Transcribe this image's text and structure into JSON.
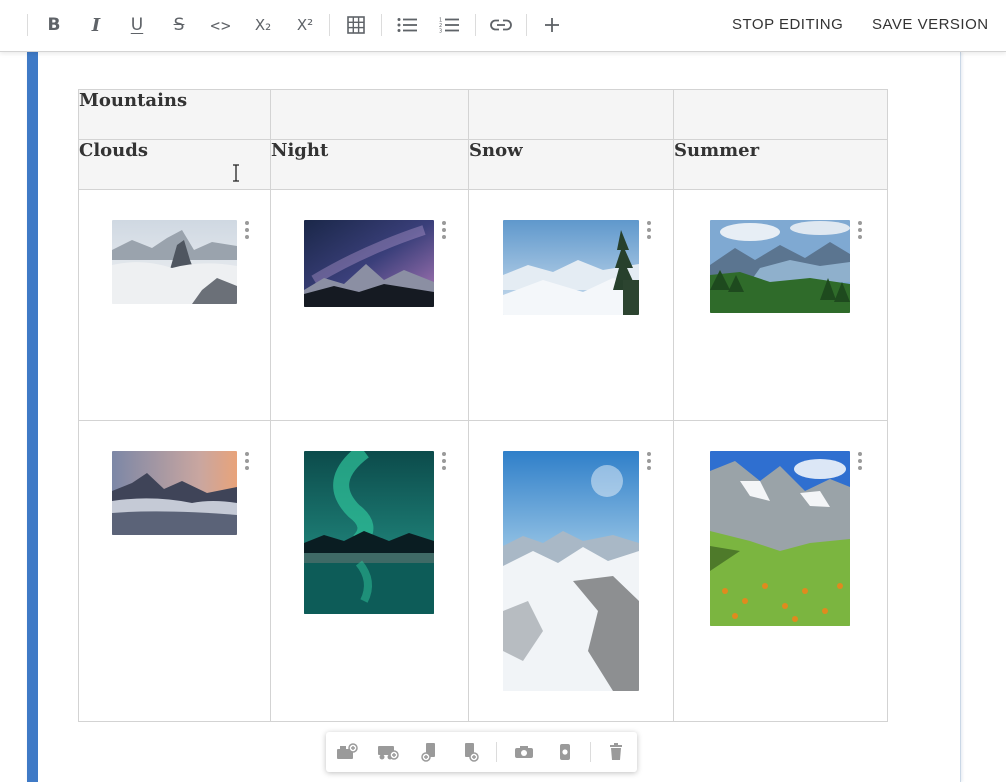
{
  "toolbar": {
    "buttons": [
      {
        "icon": "bold-icon",
        "glyph": "B"
      },
      {
        "icon": "italic-icon",
        "glyph": "I"
      },
      {
        "icon": "underline-icon",
        "glyph": "U"
      },
      {
        "icon": "strikethrough-icon",
        "glyph": "S"
      },
      {
        "icon": "code-icon",
        "glyph": "<>"
      },
      {
        "icon": "subscript-icon",
        "glyph": "X₂"
      },
      {
        "icon": "superscript-icon",
        "glyph": "X²"
      },
      {
        "icon": "table-icon"
      },
      {
        "icon": "bulleted-list-icon"
      },
      {
        "icon": "numbered-list-icon"
      },
      {
        "icon": "link-icon"
      },
      {
        "icon": "plus-icon"
      }
    ],
    "stop_editing_label": "STOP EDITING",
    "save_version_label": "SAVE VERSION"
  },
  "table": {
    "title_row": [
      "Mountains",
      "",
      "",
      ""
    ],
    "header_row": [
      "Clouds",
      "Night",
      "Snow",
      "Summer"
    ],
    "image_rows": [
      [
        {
          "alt": "Mountain peaks above clouds",
          "palette": [
            "#cfd8e2",
            "#5c6470",
            "#f2f3f4"
          ]
        },
        {
          "alt": "Mountains under the milky way at night",
          "palette": [
            "#1a2748",
            "#b07ab8",
            "#151a22"
          ]
        },
        {
          "alt": "Snowy mountain ridge with fir trees",
          "palette": [
            "#6fa3d2",
            "#dfe8f1",
            "#27402c"
          ]
        },
        {
          "alt": "Summer valley with green forest",
          "palette": [
            "#6f9fcc",
            "#44627b",
            "#2f6b2a"
          ]
        }
      ],
      [
        {
          "alt": "Mountains at sunset above sea of clouds",
          "palette": [
            "#7c87a6",
            "#e8a37a",
            "#3f4458"
          ]
        },
        {
          "alt": "Aurora over mountains and lake",
          "palette": [
            "#0c4b4b",
            "#2fc39a",
            "#0a1d22"
          ]
        },
        {
          "alt": "Snow covered mountains under blue sky",
          "palette": [
            "#2f7fc9",
            "#e9eef3",
            "#8d8f91"
          ]
        },
        {
          "alt": "Alpine meadow with flowers",
          "palette": [
            "#2f6fd0",
            "#9aa3a8",
            "#7bb540"
          ]
        }
      ]
    ]
  },
  "image_toolbar": {
    "buttons": [
      {
        "icon": "insert-row-above-icon"
      },
      {
        "icon": "insert-row-below-icon"
      },
      {
        "icon": "insert-column-left-icon"
      },
      {
        "icon": "insert-column-right-icon"
      },
      {
        "icon": "camera-icon"
      },
      {
        "icon": "phone-camera-icon"
      },
      {
        "icon": "trash-icon"
      }
    ]
  },
  "colors": {
    "accent": "#3f7ac6",
    "header_bg": "#f5f5f5",
    "border": "#d3d3d3",
    "icon": "#5f6368"
  }
}
